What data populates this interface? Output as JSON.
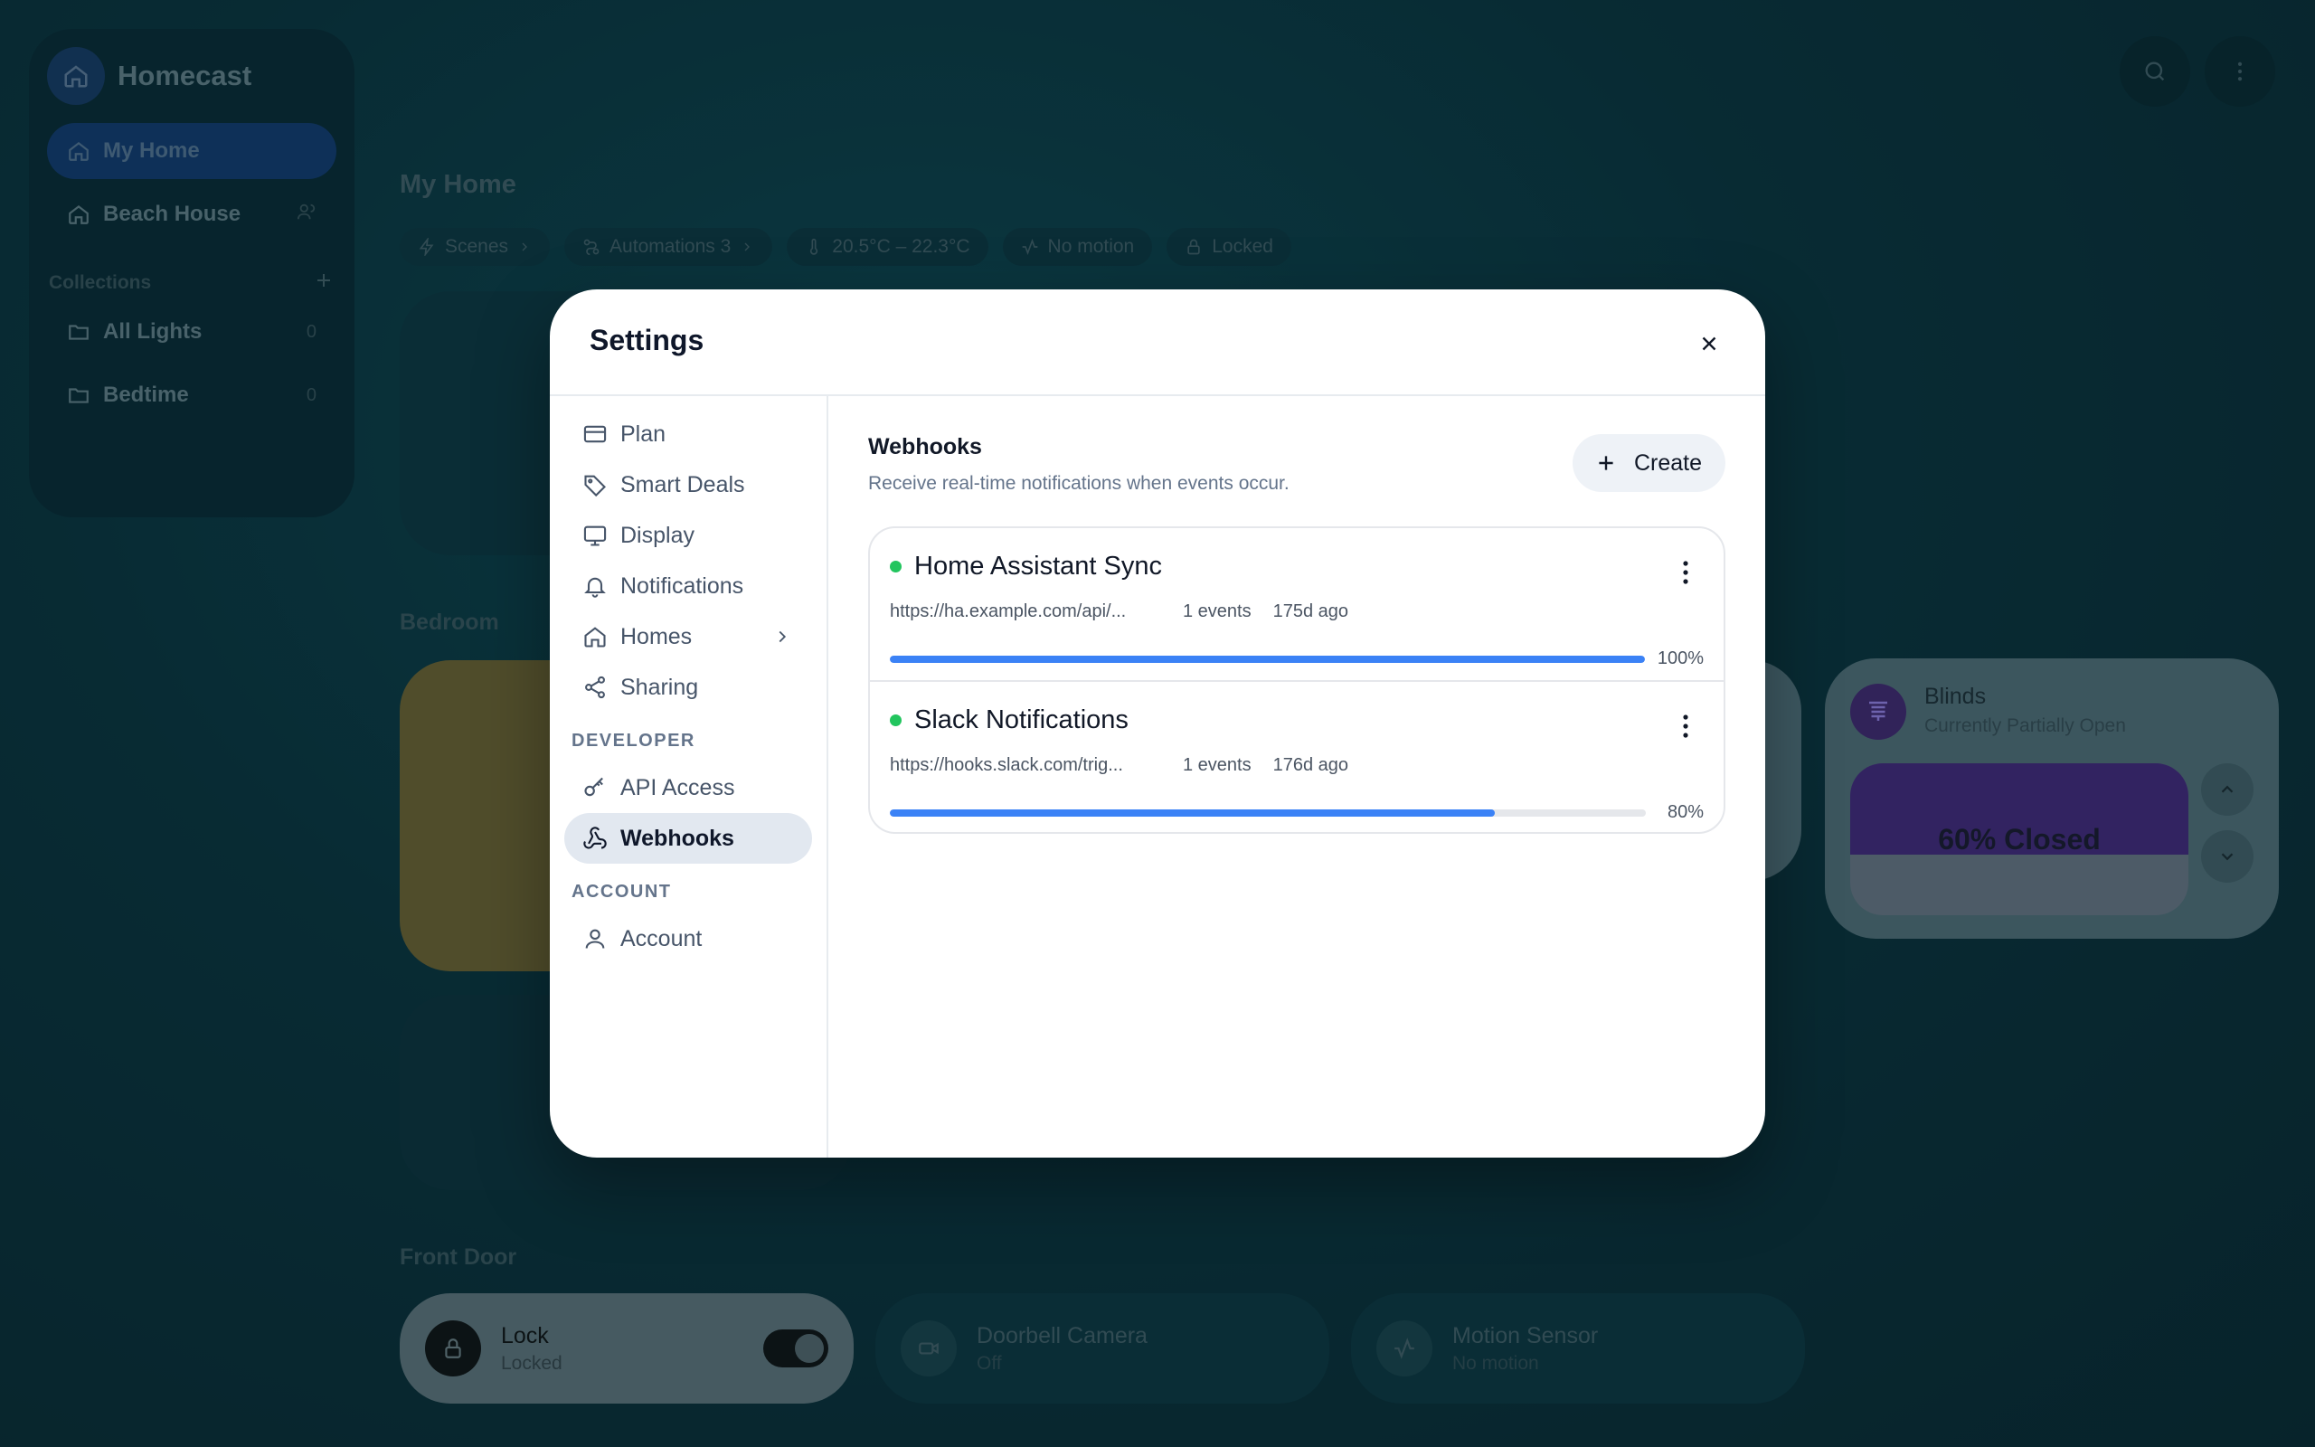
{
  "app": {
    "name": "Homecast"
  },
  "sidebar": {
    "homes": [
      {
        "label": "My Home",
        "active": true
      },
      {
        "label": "Beach House",
        "shared": true
      }
    ],
    "collections_label": "Collections",
    "collections": [
      {
        "label": "All Lights",
        "count": "0"
      },
      {
        "label": "Bedtime",
        "count": "0"
      }
    ]
  },
  "page": {
    "title": "My Home",
    "chips": [
      {
        "label": "Scenes",
        "icon": "bolt-icon"
      },
      {
        "label": "Automations 3",
        "icon": "automation-icon"
      },
      {
        "label": "20.5°C – 22.3°C",
        "icon": "thermometer-icon"
      },
      {
        "label": "No motion",
        "icon": "activity-icon"
      },
      {
        "label": "Locked",
        "icon": "lock-icon"
      }
    ],
    "bedroom_label": "Bedroom",
    "front_door_label": "Front Door",
    "blinds": {
      "title": "Blinds",
      "subtitle": "Currently Partially Open",
      "status": "60% Closed",
      "closed": 0.6
    },
    "front_door_devices": [
      {
        "title": "Lock",
        "subtitle": "Locked"
      },
      {
        "title": "Doorbell Camera",
        "subtitle": "Off"
      },
      {
        "title": "Motion Sensor",
        "subtitle": "No motion"
      }
    ]
  },
  "settings": {
    "title": "Settings",
    "nav": [
      {
        "label": "Plan",
        "icon": "card-icon"
      },
      {
        "label": "Smart Deals",
        "icon": "tag-icon"
      },
      {
        "label": "Display",
        "icon": "monitor-icon"
      },
      {
        "label": "Notifications",
        "icon": "bell-icon"
      },
      {
        "label": "Homes",
        "icon": "home-icon"
      },
      {
        "label": "Sharing",
        "icon": "share-icon"
      }
    ],
    "developer_label": "DEVELOPER",
    "developer_nav": [
      {
        "label": "API Access",
        "icon": "key-icon"
      },
      {
        "label": "Webhooks",
        "icon": "webhook-icon",
        "active": true
      }
    ],
    "account_label": "ACCOUNT",
    "account_nav": [
      {
        "label": "Account",
        "icon": "user-icon"
      }
    ],
    "webhooks": {
      "title": "Webhooks",
      "description": "Receive real-time notifications when events occur.",
      "create_label": "Create",
      "items": [
        {
          "name": "Home Assistant Sync",
          "url": "https://ha.example.com/api/...",
          "events": "1 events",
          "age": "175d ago",
          "success": 100,
          "success_label": "100%",
          "status": "active"
        },
        {
          "name": "Slack Notifications",
          "url": "https://hooks.slack.com/trig...",
          "events": "1 events",
          "age": "176d ago",
          "success": 80,
          "success_label": "80%",
          "status": "active"
        }
      ]
    }
  },
  "colors": {
    "accent": "#3b82f6",
    "status_active": "#22c55e",
    "blinds": "#7c3aed"
  }
}
